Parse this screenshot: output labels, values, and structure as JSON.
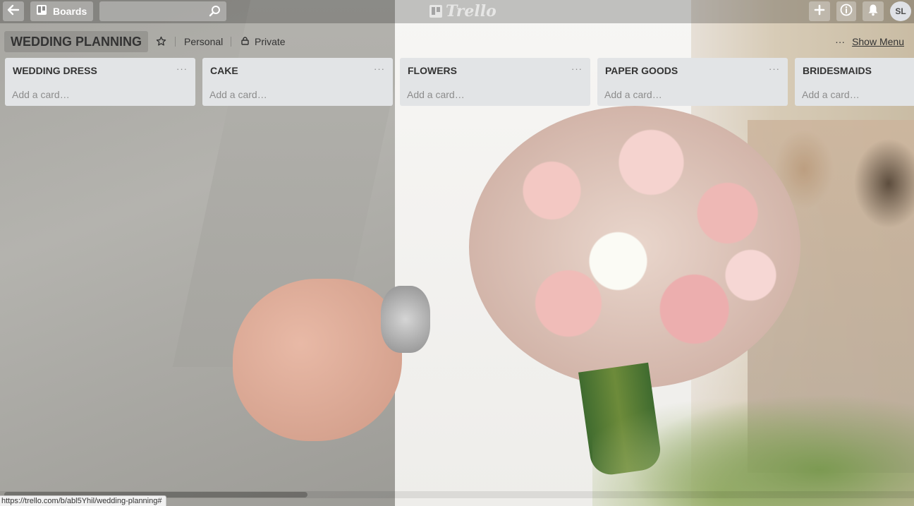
{
  "header": {
    "boards_label": "Boards",
    "search": {
      "value": "",
      "placeholder": ""
    },
    "logo_text": "Trello",
    "avatar_initials": "SL"
  },
  "board": {
    "title": "WEDDING PLANNING",
    "team": "Personal",
    "visibility": "Private",
    "show_menu_label": "Show Menu",
    "menu_dots": "···"
  },
  "lists": [
    {
      "name": "WEDDING DRESS",
      "add_card": "Add a card…",
      "menu": "···"
    },
    {
      "name": "CAKE",
      "add_card": "Add a card…",
      "menu": "···"
    },
    {
      "name": "FLOWERS",
      "add_card": "Add a card…",
      "menu": "···"
    },
    {
      "name": "PAPER GOODS",
      "add_card": "Add a card…",
      "menu": "···"
    },
    {
      "name": "BRIDESMAIDS",
      "add_card": "Add a card…",
      "menu": "···"
    }
  ],
  "status_bar": {
    "url": "https://trello.com/b/abl5Yhil/wedding-planning#"
  },
  "colors": {
    "header_bg": "rgba(0,0,0,0.22)",
    "list_bg": "#e2e4e6",
    "text": "#333333",
    "muted_text": "#8c8c8c"
  },
  "icons": {
    "back": "arrow-back-icon",
    "boards": "boards-icon",
    "search": "search-icon",
    "plus": "plus-icon",
    "info": "info-icon",
    "notifications": "bell-icon",
    "star": "star-icon",
    "lock": "lock-icon"
  }
}
